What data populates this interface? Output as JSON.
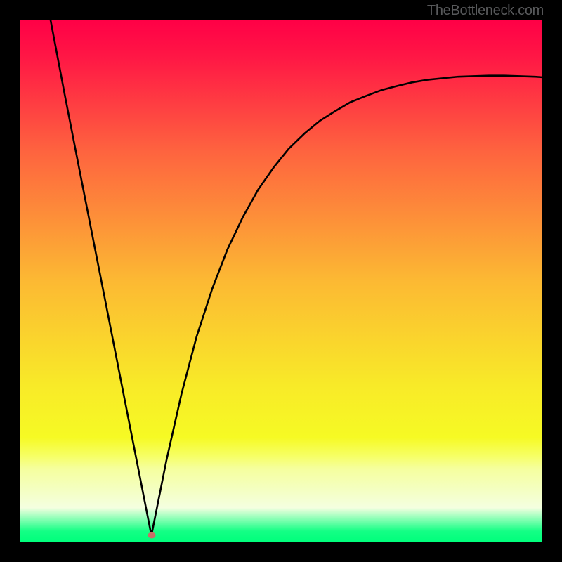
{
  "watermark": "TheBottleneck.com",
  "chart_data": {
    "type": "line",
    "title": "",
    "xlabel": "",
    "ylabel": "",
    "xlim": [
      0,
      1
    ],
    "ylim": [
      0,
      1
    ],
    "series": [
      {
        "name": "curve",
        "x": [
          0.058,
          0.085,
          0.113,
          0.141,
          0.169,
          0.197,
          0.225,
          0.2514,
          0.2514,
          0.28,
          0.309,
          0.338,
          0.368,
          0.397,
          0.427,
          0.456,
          0.486,
          0.515,
          0.545,
          0.574,
          0.604,
          0.633,
          0.663,
          0.692,
          0.722,
          0.751,
          0.781,
          0.81,
          0.84,
          0.869,
          0.899,
          0.928,
          0.958,
          0.987,
          1.0
        ],
        "y": [
          1.0,
          0.858,
          0.715,
          0.573,
          0.431,
          0.288,
          0.146,
          0.012,
          0.012,
          0.155,
          0.283,
          0.393,
          0.485,
          0.56,
          0.623,
          0.675,
          0.718,
          0.754,
          0.783,
          0.807,
          0.826,
          0.843,
          0.855,
          0.866,
          0.874,
          0.881,
          0.886,
          0.889,
          0.892,
          0.893,
          0.894,
          0.894,
          0.893,
          0.892,
          0.891
        ]
      }
    ],
    "minimum_marker": {
      "x": 0.2514,
      "y": 0.012
    },
    "gradient_stops": [
      {
        "pos": 0.0,
        "color": "#FF0046"
      },
      {
        "pos": 0.07,
        "color": "#FF1745"
      },
      {
        "pos": 0.25,
        "color": "#FE633F"
      },
      {
        "pos": 0.5,
        "color": "#FCB933"
      },
      {
        "pos": 0.7,
        "color": "#F8EA28"
      },
      {
        "pos": 0.8,
        "color": "#F6FA24"
      },
      {
        "pos": 0.835,
        "color": "#F6FF64"
      },
      {
        "pos": 0.86,
        "color": "#F5FF9E"
      },
      {
        "pos": 0.935,
        "color": "#F4FFE0"
      },
      {
        "pos": 0.98,
        "color": "#14FF85"
      },
      {
        "pos": 1.0,
        "color": "#00FF7C"
      }
    ]
  }
}
